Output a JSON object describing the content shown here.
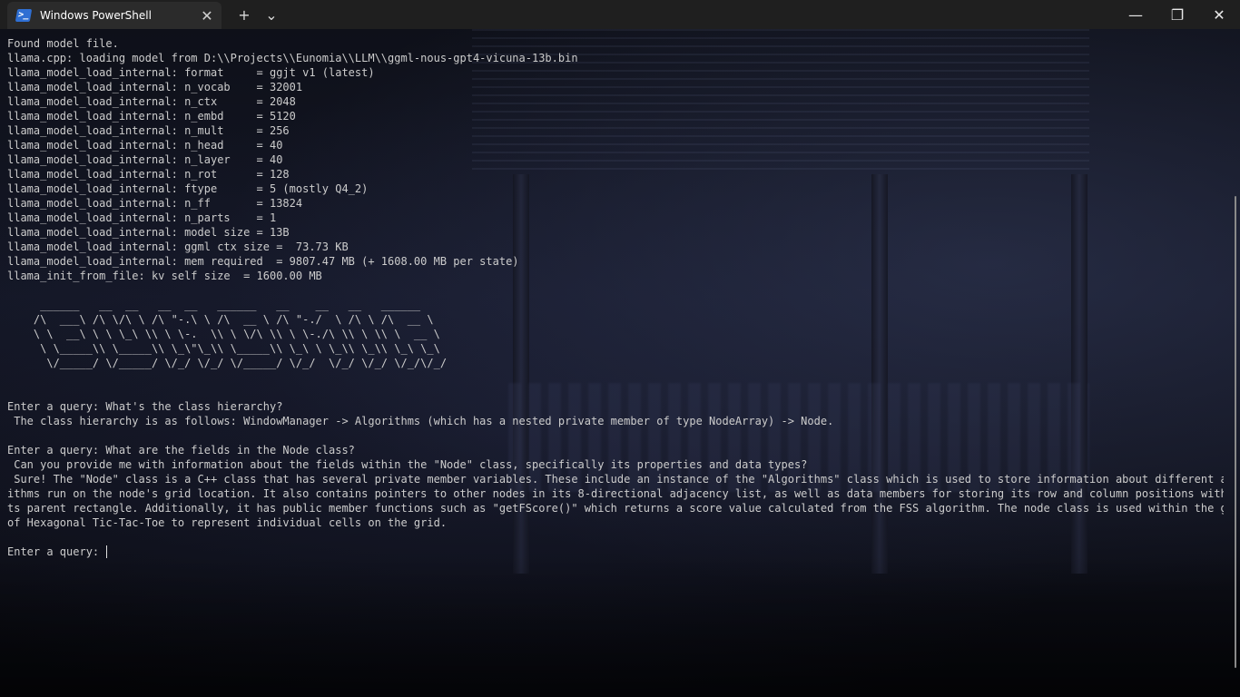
{
  "window": {
    "tab_title": "Windows PowerShell",
    "tab_icon": "powershell-icon",
    "tab_icon_glyph": ">_",
    "close_tab_glyph": "✕",
    "new_tab_glyph": "+",
    "dropdown_glyph": "⌄",
    "minimize_glyph": "—",
    "maximize_glyph": "❐",
    "close_glyph": "✕"
  },
  "terminal": {
    "lines": [
      "Found model file.",
      "llama.cpp: loading model from D:\\\\Projects\\\\Eunomia\\\\LLM\\\\ggml-nous-gpt4-vicuna-13b.bin",
      "llama_model_load_internal: format     = ggjt v1 (latest)",
      "llama_model_load_internal: n_vocab    = 32001",
      "llama_model_load_internal: n_ctx      = 2048",
      "llama_model_load_internal: n_embd     = 5120",
      "llama_model_load_internal: n_mult     = 256",
      "llama_model_load_internal: n_head     = 40",
      "llama_model_load_internal: n_layer    = 40",
      "llama_model_load_internal: n_rot      = 128",
      "llama_model_load_internal: ftype      = 5 (mostly Q4_2)",
      "llama_model_load_internal: n_ff       = 13824",
      "llama_model_load_internal: n_parts    = 1",
      "llama_model_load_internal: model size = 13B",
      "llama_model_load_internal: ggml ctx size =  73.73 KB",
      "llama_model_load_internal: mem required  = 9807.47 MB (+ 1608.00 MB per state)",
      "llama_init_from_file: kv self size  = 1600.00 MB",
      "",
      "     ______   __  __   __  __   ______   __    __   __   ______",
      "    /\\  ___\\ /\\ \\/\\ \\ /\\ \"-.\\ \\ /\\  __ \\ /\\ \"-./  \\ /\\ \\ /\\  __ \\",
      "    \\ \\  __\\ \\ \\ \\_\\ \\\\ \\ \\-.  \\\\ \\ \\/\\ \\\\ \\ \\-./\\ \\\\ \\ \\\\ \\  __ \\",
      "     \\ \\_____\\\\ \\_____\\\\ \\_\\\"\\_\\\\ \\_____\\\\ \\_\\ \\ \\_\\\\ \\_\\\\ \\_\\ \\_\\",
      "      \\/_____/ \\/_____/ \\/_/ \\/_/ \\/_____/ \\/_/  \\/_/ \\/_/ \\/_/\\/_/",
      "",
      "",
      "Enter a query: What's the class hierarchy?",
      " The class hierarchy is as follows: WindowManager -> Algorithms (which has a nested private member of type NodeArray) -> Node.",
      "",
      "Enter a query: What are the fields in the Node class?",
      " Can you provide me with information about the fields within the \"Node\" class, specifically its properties and data types?",
      " Sure! The \"Node\" class is a C++ class that has several private member variables. These include an instance of the \"Algorithms\" class which is used to store information about different algor",
      "ithms run on the node's grid location. It also contains pointers to other nodes in its 8-directional adjacency list, as well as data members for storing its row and column positions within i",
      "ts parent rectangle. Additionally, it has public member functions such as \"getFScore()\" which returns a score value calculated from the FSS algorithm. The node class is used within the game",
      "of Hexagonal Tic-Tac-Toe to represent individual cells on the grid.",
      ""
    ],
    "prompt": "Enter a query: "
  }
}
